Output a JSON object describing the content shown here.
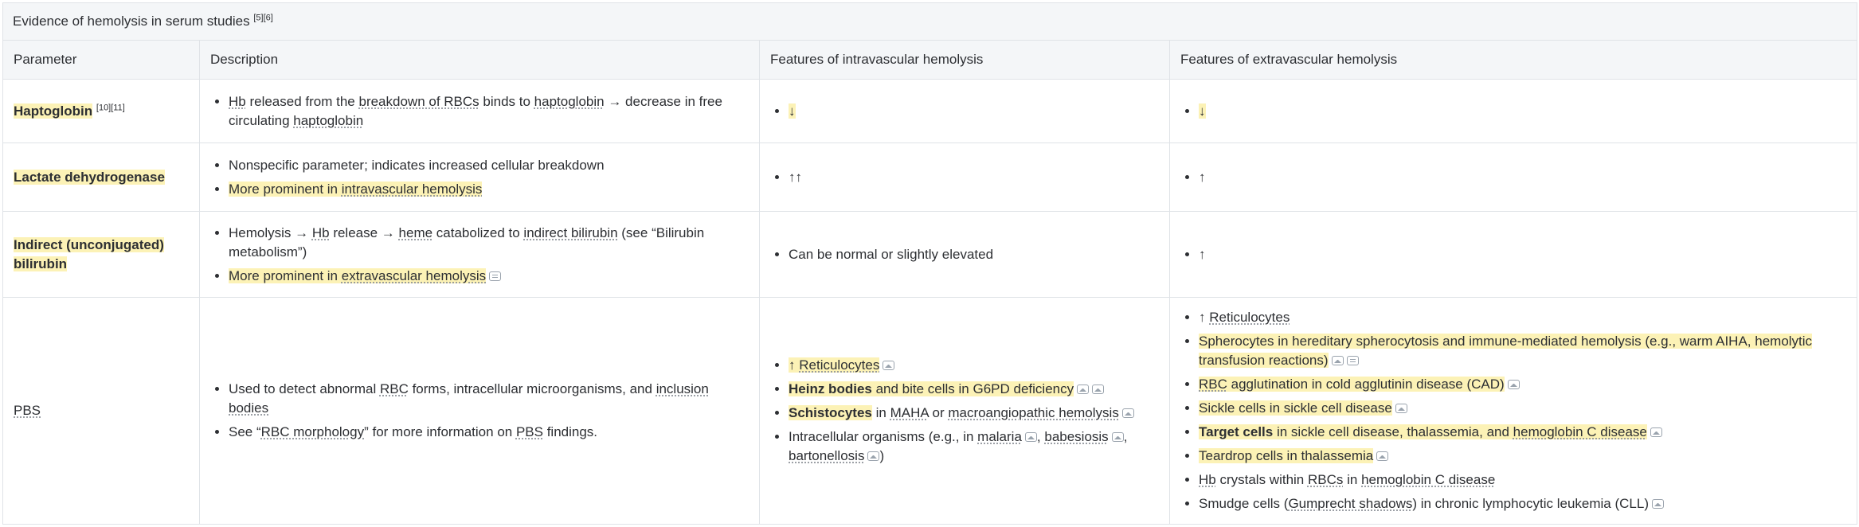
{
  "table": {
    "caption": "Evidence of hemolysis in serum studies",
    "caption_refs": "[5][6]",
    "headers": [
      "Parameter",
      "Description",
      "Features of intravascular hemolysis",
      "Features of extravascular hemolysis"
    ],
    "rows": {
      "haptoglobin": {
        "name": "Haptoglobin",
        "refs": "[10][11]",
        "description": {
          "d1": [
            "Hb",
            " released from the ",
            "breakdown of RBCs",
            " binds to ",
            "haptoglobin",
            " → decrease in free circulating ",
            "haptoglobin"
          ]
        },
        "intravascular": "↓",
        "extravascular": "↓"
      },
      "ldh": {
        "name": "Lactate dehydrogenase",
        "description": {
          "d1": "Nonspecific parameter; indicates increased cellular breakdown",
          "d2": [
            "More prominent in ",
            "intravascular hemolysis"
          ]
        },
        "intravascular": "↑↑",
        "extravascular": "↑"
      },
      "bilirubin": {
        "name": "Indirect (unconjugated) bilirubin",
        "description": {
          "d1": [
            "Hemolysis → ",
            "Hb",
            " release → ",
            "heme",
            " catabolized to ",
            "indirect bilirubin",
            " (see “Bilirubin metabolism”)"
          ],
          "d2": [
            "More prominent in ",
            "extravascular hemolysis"
          ]
        },
        "intravascular": "Can be normal or slightly elevated",
        "extravascular": "↑"
      },
      "pbs": {
        "name": "PBS",
        "description": {
          "d1": [
            "Used to detect abnormal ",
            "RBC",
            " forms, intracellular microorganisms, and ",
            "inclusion bodies"
          ],
          "d2": [
            "See “",
            "RBC morphology",
            "” for more information on ",
            "PBS",
            " findings."
          ]
        },
        "intravascular": {
          "i1": [
            "↑ ",
            "Reticulocytes"
          ],
          "i2": [
            "Heinz bodies",
            " and bite cells in G6PD deficiency"
          ],
          "i3": [
            "Schistocytes",
            " in ",
            "MAHA",
            " or ",
            "macroangiopathic hemolysis"
          ],
          "i4": [
            "Intracellular organisms (e.g., in ",
            "malaria",
            ", ",
            "babesiosis",
            ", ",
            "bartonellosis",
            ")"
          ]
        },
        "extravascular": {
          "e1": [
            "↑ ",
            "Reticulocytes"
          ],
          "e2": "Spherocytes in hereditary spherocytosis and immune-mediated hemolysis (e.g., warm AIHA, hemolytic transfusion reactions)",
          "e3": [
            "RBC",
            " agglutination in cold agglutinin disease (CAD)"
          ],
          "e4": "Sickle cells in sickle cell disease",
          "e5": [
            "Target cells",
            " in sickle cell disease, thalassemia, and ",
            "hemoglobin C disease"
          ],
          "e6": "Teardrop cells in thalassemia",
          "e7": [
            "Hb",
            " crystals within ",
            "RBCs",
            " in ",
            "hemoglobin C disease"
          ],
          "e8": [
            "Smudge cells (",
            "Gumprecht shadows",
            ") in chronic lymphocytic leukemia (CLL)"
          ]
        }
      }
    }
  }
}
